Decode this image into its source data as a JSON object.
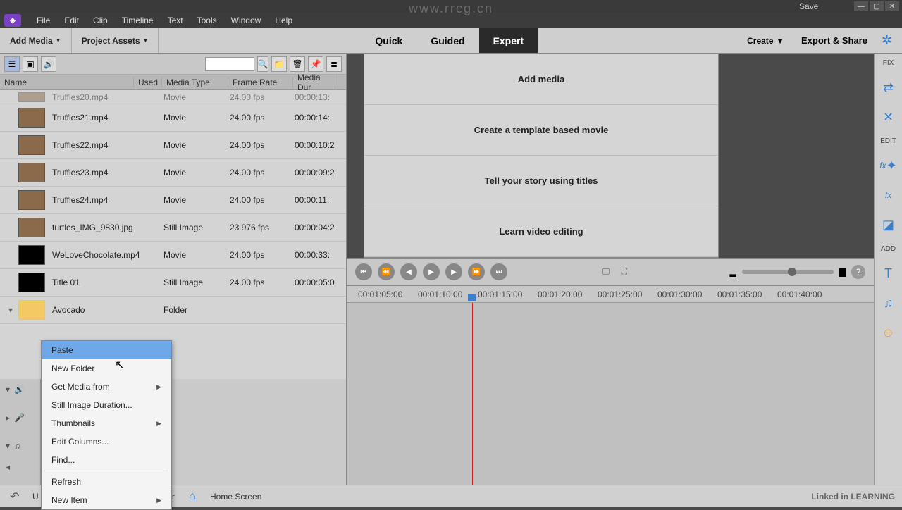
{
  "watermark": "www.rrcg.cn",
  "titlebar": {
    "save": "Save"
  },
  "menu": {
    "items": [
      "File",
      "Edit",
      "Clip",
      "Timeline",
      "Text",
      "Tools",
      "Window",
      "Help"
    ]
  },
  "toprow": {
    "addMedia": "Add Media",
    "projectAssets": "Project Assets",
    "tabs": {
      "quick": "Quick",
      "guided": "Guided",
      "expert": "Expert"
    },
    "create": "Create",
    "export": "Export & Share"
  },
  "assetHeaders": {
    "name": "Name",
    "used": "Used",
    "type": "Media Type",
    "rate": "Frame Rate",
    "dur": "Media Dur"
  },
  "assets": [
    {
      "name": "Truffles20.mp4",
      "type": "Movie",
      "rate": "24.00 fps",
      "dur": "00:00:13:"
    },
    {
      "name": "Truffles21.mp4",
      "type": "Movie",
      "rate": "24.00 fps",
      "dur": "00:00:14:"
    },
    {
      "name": "Truffles22.mp4",
      "type": "Movie",
      "rate": "24.00 fps",
      "dur": "00:00:10:2"
    },
    {
      "name": "Truffles23.mp4",
      "type": "Movie",
      "rate": "24.00 fps",
      "dur": "00:00:09:2"
    },
    {
      "name": "Truffles24.mp4",
      "type": "Movie",
      "rate": "24.00 fps",
      "dur": "00:00:11:"
    },
    {
      "name": "turtles_IMG_9830.jpg",
      "type": "Still Image",
      "rate": "23.976 fps",
      "dur": "00:00:04:2"
    },
    {
      "name": "WeLoveChocolate.mp4",
      "type": "Movie",
      "rate": "24.00 fps",
      "dur": "00:00:33:"
    },
    {
      "name": "Title 01",
      "type": "Still Image",
      "rate": "24.00 fps",
      "dur": "00:00:05:0"
    },
    {
      "name": "Avocado",
      "type": "Folder",
      "rate": "",
      "dur": ""
    }
  ],
  "welcome": {
    "addMedia": "Add media",
    "template": "Create a template based movie",
    "titles": "Tell your story using titles",
    "learn": "Learn video editing"
  },
  "ruler": [
    "00:01:05:00",
    "00:01:10:00",
    "00:01:15:00",
    "00:01:20:00",
    "00:01:25:00",
    "00:01:30:00",
    "00:01:35:00",
    "00:01:40:00"
  ],
  "sidetools": {
    "fix": "FIX",
    "edit": "EDIT",
    "add": "ADD"
  },
  "ctx": {
    "paste": "Paste",
    "newFolder": "New Folder",
    "getMedia": "Get Media from",
    "stillDur": "Still Image Duration...",
    "thumbs": "Thumbnails",
    "editCols": "Edit Columns...",
    "find": "Find...",
    "refresh": "Refresh",
    "newItem": "New Item"
  },
  "bottom": {
    "organizer": "izer",
    "home": "Home Screen",
    "brand": "Linked in LEARNING",
    "undo": "U"
  }
}
